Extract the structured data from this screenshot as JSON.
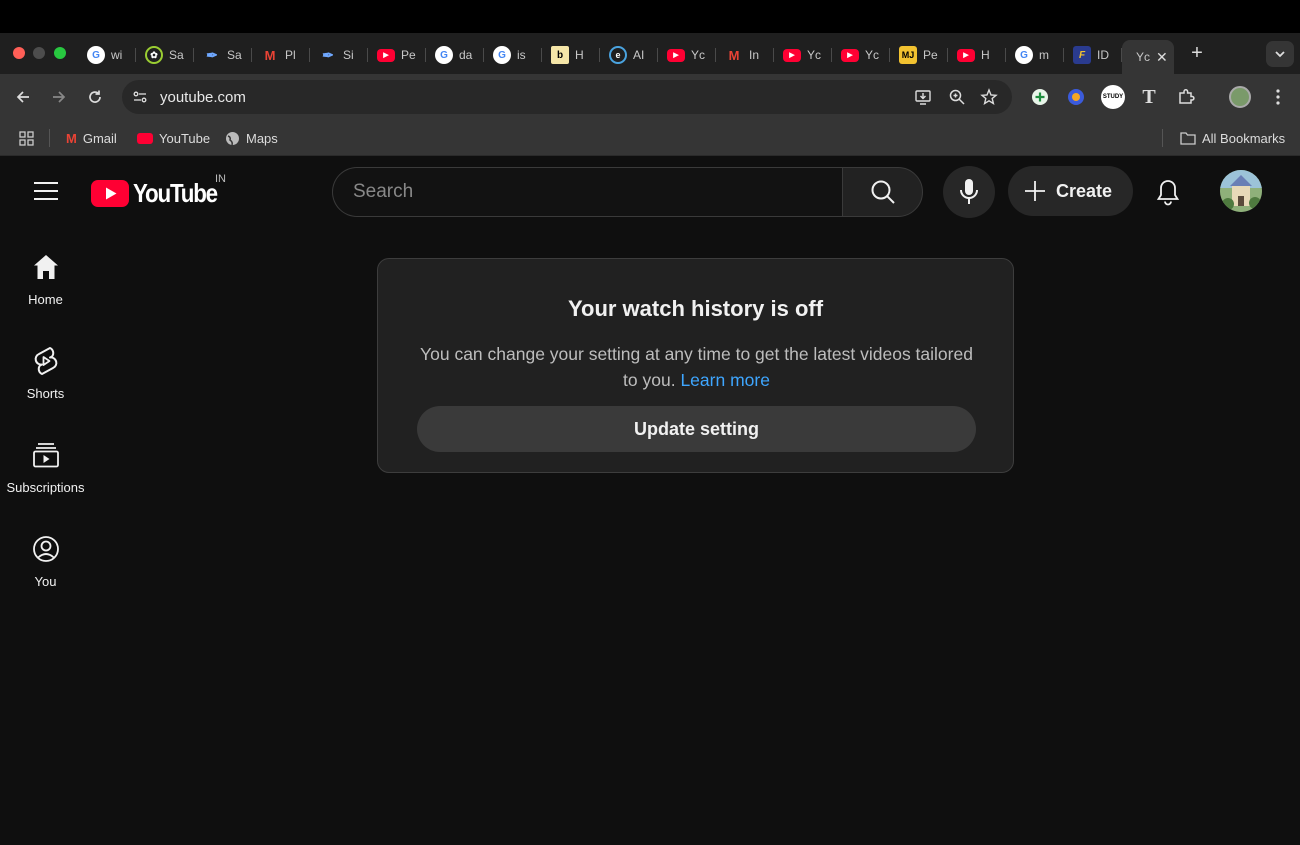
{
  "browser": {
    "tabs": [
      {
        "label": "wi",
        "icon": "google-icon"
      },
      {
        "label": "Sa",
        "icon": "chatgpt-icon"
      },
      {
        "label": "Sa",
        "icon": "quill-icon"
      },
      {
        "label": "Pl",
        "icon": "gmail-icon"
      },
      {
        "label": "Si",
        "icon": "quill-icon"
      },
      {
        "label": "Pe",
        "icon": "youtube-icon"
      },
      {
        "label": "da",
        "icon": "google-icon"
      },
      {
        "label": "is",
        "icon": "google-icon"
      },
      {
        "label": "H",
        "icon": "b-icon"
      },
      {
        "label": "AI",
        "icon": "edge-icon"
      },
      {
        "label": "Yc",
        "icon": "youtube-icon"
      },
      {
        "label": "In",
        "icon": "gmail-icon"
      },
      {
        "label": "Yc",
        "icon": "youtube-icon"
      },
      {
        "label": "Yc",
        "icon": "youtube-icon"
      },
      {
        "label": "Pe",
        "icon": "mj-icon"
      },
      {
        "label": "H",
        "icon": "youtube-icon"
      },
      {
        "label": "m",
        "icon": "google-icon"
      },
      {
        "label": "ID",
        "icon": "f-icon"
      }
    ],
    "active_tab": {
      "label": "Yc",
      "close": "✕"
    },
    "new_tab": "+",
    "url": "youtube.com",
    "bookmarks": [
      {
        "label": "Gmail",
        "icon": "gmail-icon"
      },
      {
        "label": "YouTube",
        "icon": "youtube-icon"
      },
      {
        "label": "Maps",
        "icon": "globe-icon"
      }
    ],
    "all_bookmarks": "All Bookmarks",
    "study_badge": "STUDY"
  },
  "youtube": {
    "logo_text": "YouTube",
    "region": "IN",
    "search_placeholder": "Search",
    "create_label": "Create",
    "sidebar": [
      {
        "label": "Home",
        "icon": "home-icon"
      },
      {
        "label": "Shorts",
        "icon": "shorts-icon"
      },
      {
        "label": "Subscriptions",
        "icon": "subscriptions-icon"
      },
      {
        "label": "You",
        "icon": "you-icon"
      }
    ],
    "card": {
      "title": "Your watch history is off",
      "body": "You can change your setting at any time to get the latest videos tailored to you.",
      "link": "Learn more",
      "button": "Update setting"
    }
  },
  "colors": {
    "background": "#0f0f0f",
    "youtube_red": "#ff0033",
    "link_blue": "#3ea6ff"
  }
}
